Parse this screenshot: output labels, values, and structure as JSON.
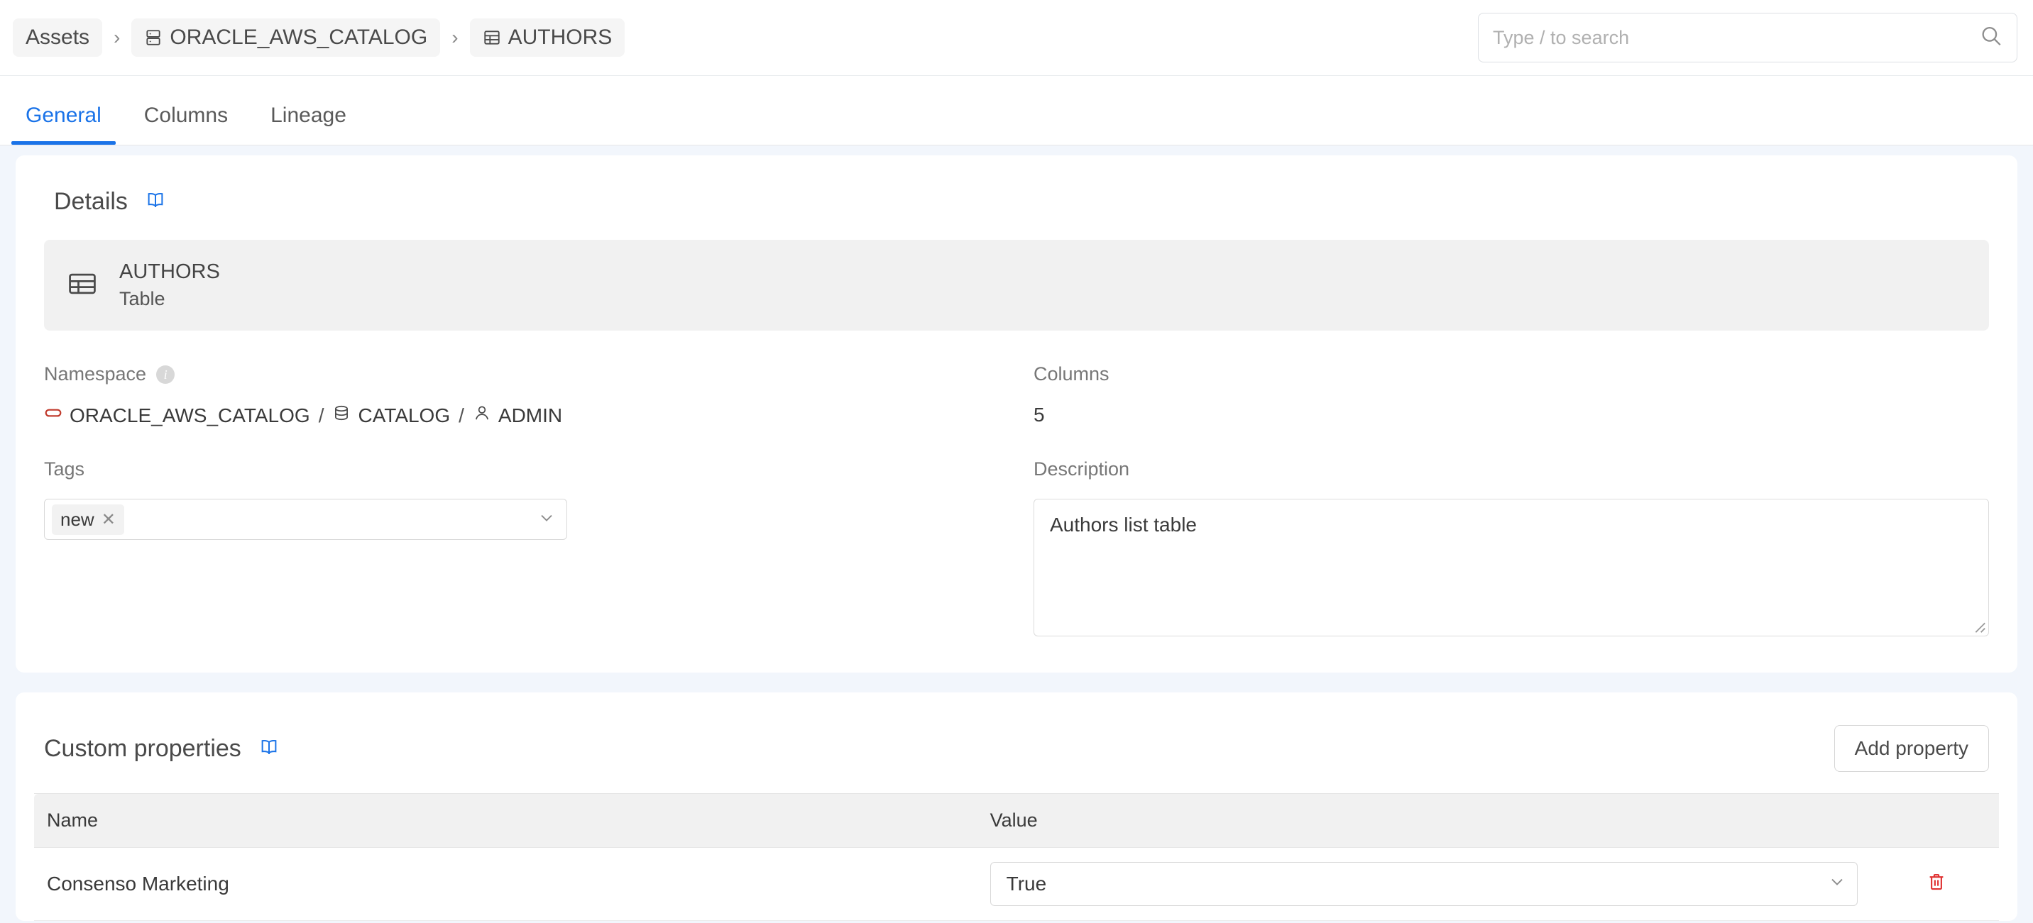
{
  "header": {
    "breadcrumb": [
      {
        "label": "Assets",
        "icon": null
      },
      {
        "label": "ORACLE_AWS_CATALOG",
        "icon": "database-server-icon"
      },
      {
        "label": "AUTHORS",
        "icon": "table-icon"
      }
    ],
    "separator": "›",
    "search": {
      "placeholder": "Type / to search",
      "value": "",
      "icon": "search-icon"
    }
  },
  "tabs": [
    {
      "label": "General",
      "active": true
    },
    {
      "label": "Columns",
      "active": false
    },
    {
      "label": "Lineage",
      "active": false
    }
  ],
  "details": {
    "title": "Details",
    "doc_icon": "book-icon",
    "asset": {
      "icon": "table-icon",
      "name": "AUTHORS",
      "type": "Table"
    },
    "namespace": {
      "label": "Namespace",
      "info_icon": "info-icon",
      "parts": [
        {
          "icon": "oval-icon",
          "text": "ORACLE_AWS_CATALOG"
        },
        {
          "icon": "database-icon",
          "text": "CATALOG"
        },
        {
          "icon": "user-icon",
          "text": "ADMIN"
        }
      ],
      "separator": "/"
    },
    "columns": {
      "label": "Columns",
      "value": "5"
    },
    "tags": {
      "label": "Tags",
      "chips": [
        {
          "text": "new",
          "remove_icon": "close-icon"
        }
      ],
      "chevron_icon": "chevron-down-icon"
    },
    "description": {
      "label": "Description",
      "value": "Authors list table",
      "placeholder": ""
    }
  },
  "custom_properties": {
    "title": "Custom properties",
    "doc_icon": "book-icon",
    "add_button": "Add property",
    "columns": [
      "Name",
      "Value"
    ],
    "rows": [
      {
        "name": "Consenso Marketing",
        "value": "True",
        "chevron_icon": "chevron-down-icon",
        "delete_icon": "trash-icon"
      }
    ]
  },
  "colors": {
    "accent": "#1a73e8",
    "page_bg": "#f2f6fc",
    "danger": "#e03131",
    "namespace_oval": "#c0392b"
  }
}
